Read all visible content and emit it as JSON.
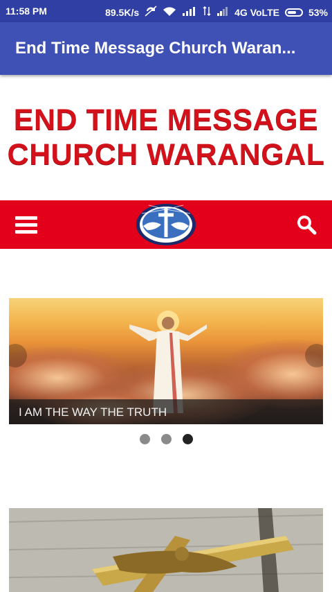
{
  "status_bar": {
    "time": "11:58 PM",
    "speed": "89.5K/s",
    "network": "4G VoLTE",
    "battery": "53%"
  },
  "app_bar": {
    "title": "End Time Message Church Waran..."
  },
  "header": {
    "line1": "END TIME MESSAGE",
    "line2": "CHURCH WARANGAL"
  },
  "nav": {
    "menu_icon": "hamburger-menu-icon",
    "logo_icon": "church-logo",
    "search_icon": "search-icon",
    "bar_color": "#e2001a"
  },
  "slider": {
    "caption": "I AM THE WAY THE TRUTH",
    "total_slides": 3,
    "active_index": 2
  },
  "colors": {
    "status_bar": "#2f3fa3",
    "app_bar": "#3f51b5",
    "title_red": "#d2111b"
  }
}
